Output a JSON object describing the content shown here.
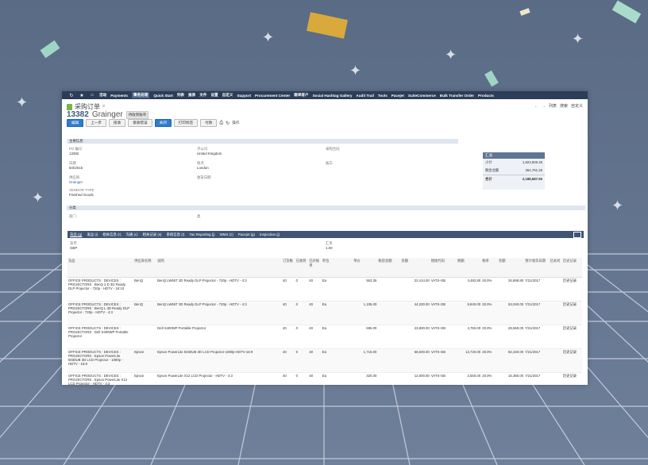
{
  "nav": {
    "icons": [
      "history-icon",
      "star-icon",
      "home-icon"
    ],
    "items": [
      "活动",
      "Payments",
      "事务处理",
      "Quick Start",
      "列表",
      "报表",
      "文件",
      "设置",
      "自定义",
      "Support",
      "Procurement Center",
      "跟单客户",
      "Social Hashtag Gallery",
      "Audit Trail",
      "Tools",
      "Pacejet",
      "SuiteCommerce",
      "Bulk Transfer Order",
      "Products"
    ],
    "active_index": 2
  },
  "header": {
    "page_title": "采购订单",
    "record_number": "13382",
    "vendor_name": "Grainger",
    "status_badge": "待收到账单",
    "right_links": [
      "列表",
      "搜索",
      "自定义"
    ]
  },
  "toolbar": {
    "buttons": [
      "编辑",
      "上一步",
      "接收",
      "接收错误",
      "关闭",
      "打印标签",
      "付款"
    ],
    "primary_index": 4,
    "actions_label": "操作"
  },
  "primary_section": {
    "title": "主要信息"
  },
  "fields": {
    "po_label": "PO 编号",
    "po_value": "13382",
    "date_label": "日期",
    "date_value": "8/3/2015",
    "vendor_label": "供应商",
    "vendor_value": "Grainger",
    "vendor_type_label": "VENDOR TYPE",
    "vendor_type_value": "Finished Goods",
    "subsidiary_label": "子公司",
    "subsidiary_value": "United Kingdom",
    "location_label": "地点",
    "location_value": "London",
    "receive_date_label": "收货日期",
    "status_label": "采购合同",
    "memo_label": "备忘"
  },
  "summary": {
    "title": "汇总",
    "subtotal_label": "小计",
    "subtotal_value": "1,823,906.25",
    "tax_label": "税金总额",
    "tax_value": "364,781.25",
    "total_label": "合计",
    "total_value": "2,188,687.50"
  },
  "classification": {
    "title": "分类",
    "department_label": "部门",
    "class_label": "类"
  },
  "tabs": [
    "货品 (g)",
    "发运 (i)",
    "相关信息 (r)",
    "沟通 (c)",
    "相关记录 (s)",
    "系统信息 (t)",
    "Tax Reporting (j)",
    "WMS (z)",
    "Pacejet (g)",
    "Inspection (j)"
  ],
  "currency": {
    "currency_label": "货币",
    "currency_value": "GBP",
    "rate_label": "汇率",
    "rate_value": "1.00"
  },
  "table": {
    "headers": [
      "货品",
      "供应商名称",
      "说明",
      "订货数",
      "已收到",
      "已开账单",
      "单位",
      "单价",
      "税前金额",
      "金额",
      "税收代码",
      "税额",
      "税率",
      "毛额",
      "预计收货日期",
      "已关闭",
      "历史记录"
    ],
    "rows": [
      [
        "OFFICE PRODUCTS : DEVICES : PROJECTORS : BenQ 3 D 3D Ready DLP Projector - 720p - HDTV - 16:10",
        "BenQ",
        "BenQ LW65T 3D Ready DLP Projector - 720p - HDTV - 4:3",
        "40",
        "0",
        "40",
        "Ea",
        "563.35",
        "",
        "22,414.00",
        "VATS-GB",
        "4,482.80",
        "20.0%",
        "26,898.80",
        "7/21/2017",
        "",
        "历史记录"
      ],
      [
        "OFFICE PRODUCTS : DEVICES : PROJECTORS : BenQ L 3D Ready DLP Projector - 720p - HDTV - 4:3",
        "BenQ",
        "BenQ LW65T 3D Ready DLP Projector - 720p - HDTV - 4:3",
        "40",
        "0",
        "40",
        "Ea",
        "1,105.00",
        "",
        "44,200.00",
        "VATS-GB",
        "8,840.00",
        "20.0%",
        "53,040.00",
        "7/21/2017",
        "",
        "历史记录"
      ],
      [
        "OFFICE PRODUCTS : DEVICES : PROJECTORS : Dell S400WP Portable Projector",
        "",
        "Dell S400WP Portable Projector",
        "40",
        "0",
        "40",
        "Ea",
        "595.00",
        "",
        "23,800.00",
        "VATS-GB",
        "4,760.00",
        "20.0%",
        "28,560.00",
        "7/21/2017",
        "",
        "历史记录"
      ],
      [
        "OFFICE PRODUCTS : DEVICES : PROJECTORS : Epson PowerLite 5030UB 3D LCD Projector - 1080p - HDTV - 16:9",
        "Epson",
        "Epson PowerLite 5030UB 3D LCD Projector-1080p-HDTV-16:9",
        "40",
        "0",
        "40",
        "Ea",
        "1,715.00",
        "",
        "68,600.00",
        "VATS-GB",
        "13,720.00",
        "20.0%",
        "82,320.00",
        "7/21/2017",
        "",
        "历史记录"
      ],
      [
        "OFFICE PRODUCTS : DEVICES : PROJECTORS : Epson PowerLite X12 LCD Projector - HDTV - 4:3",
        "Epson",
        "Epson PowerLite X12 LCD Projector - HDTV - 4:3",
        "40",
        "0",
        "40",
        "Ea",
        "320.00",
        "",
        "12,800.00",
        "VATS-GB",
        "2,560.00",
        "20.0%",
        "15,360.00",
        "7/21/2017",
        "",
        "历史记录"
      ]
    ]
  }
}
